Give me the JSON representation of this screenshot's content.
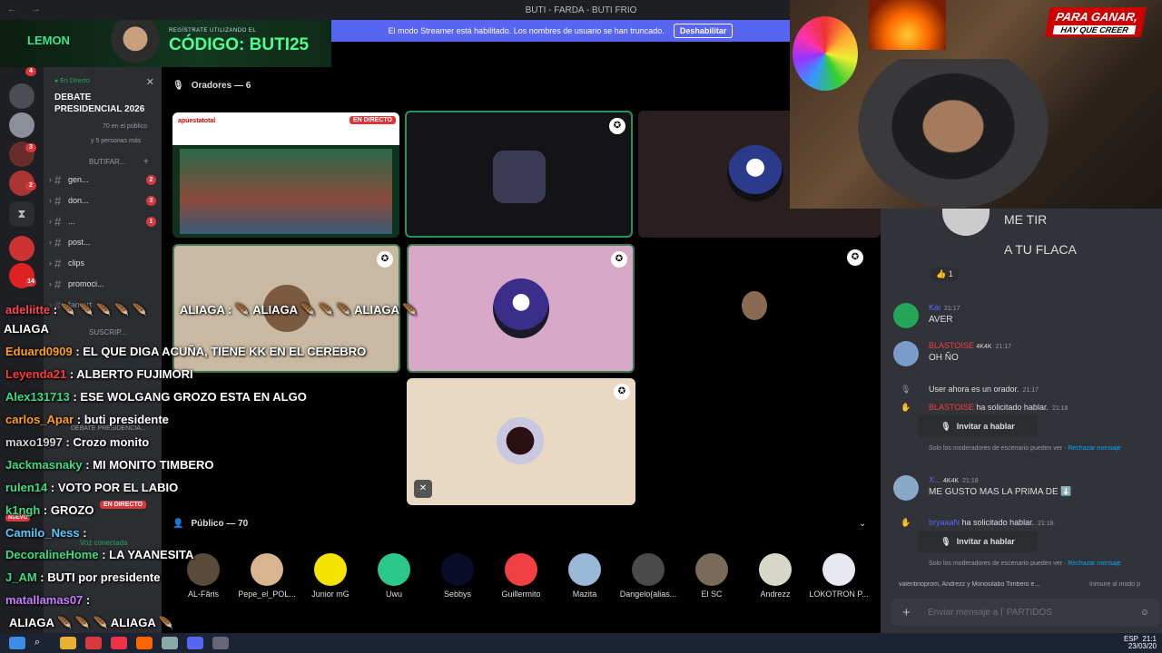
{
  "window": {
    "title": "BUTI - FARDA - BUTI FRIO",
    "nav_arrows": "← →"
  },
  "streamer_banner": {
    "text": "El modo Streamer está habilitado. Los nombres de usuario se han truncado.",
    "button": "Deshabilitar"
  },
  "promo": {
    "brand": "LEMON",
    "hint": "REGÍSTRATE UTILIZANDO EL",
    "code": "CÓDIGO: BUTI25"
  },
  "server_rail": {
    "badges": [
      "4",
      "3",
      "2",
      "14"
    ]
  },
  "channel_list": {
    "live_label": "En Directo",
    "event_title": "DEBATE PRESIDENCIAL 2026",
    "audience": "70 en el público",
    "people": "y 5 personas más",
    "category": "BUTIFAR...",
    "channels": [
      {
        "name": "gen...",
        "count": "2"
      },
      {
        "name": "don...",
        "count": "3"
      },
      {
        "name": "...",
        "count": "1"
      },
      {
        "name": "post...",
        "count": ""
      },
      {
        "name": "clips",
        "count": ""
      },
      {
        "name": "promoci...",
        "count": ""
      },
      {
        "name": "fan-art",
        "count": ""
      }
    ],
    "category2": "SUSCRIP...",
    "voice_label": "DEBATE PRESIDENCIA...",
    "voice_status": "Voz conectada",
    "live_badge": "EN DIRECTO",
    "nuevo": "NUEVO"
  },
  "stage": {
    "speakers_header": "Oradores — 6",
    "audience_header": "Público — 70",
    "en_directo": "EN DIRECTO",
    "stream_brand": "apuestatotal",
    "audience": [
      "AL-Fâris",
      "Pepe_el_POL...",
      "Junior mG",
      "Uwu",
      "Sebbys",
      "Guillermito",
      "Mazita",
      "Dangelo(alias...",
      "El SC",
      "Andrezz",
      "LOKOTRON P..."
    ]
  },
  "webcam": {
    "slogan_top": "PARA GANAR,",
    "slogan_bottom": "HAY QUE CREER"
  },
  "chat": {
    "top_lines": [
      "ME TIR",
      "A TU FLACA"
    ],
    "reaction_count": "1",
    "messages": [
      {
        "user": "Kai",
        "time": "21:17",
        "text": "AVER",
        "color": "#5865f2"
      },
      {
        "user": "BLASTOISE",
        "tag": "4K4K",
        "time": "21:17",
        "text": "OH ÑO",
        "color": "#f23f43"
      }
    ],
    "system": [
      {
        "text": "User ahora es un orador.",
        "time": "21:17"
      },
      {
        "user": "BLASTOISE",
        "text": "ha solicitado hablar.",
        "time": "21:18"
      }
    ],
    "invite_label": "Invitar a hablar",
    "mod_note": "Solo los moderadores de escenario pueden ver",
    "mod_link": "Rechazar mensaje",
    "msg3": {
      "user": "X...",
      "tag": "4K4K",
      "time": "21:18",
      "text": "ME GUSTO MAS LA PRIMA DE ⬇️"
    },
    "req2": {
      "user": "bryaaaN",
      "text": "ha solicitado hablar.",
      "time": "21:18"
    },
    "typing": "valentinoprom, Andrezz y Monosilabo Timbero e...",
    "typing_right": "Inmune al modo p",
    "input_placeholder": "Enviar mensaje a",
    "input_channel": "PARTIDOS"
  },
  "overlay": [
    {
      "user": "adeliitte",
      "text": "",
      "color": "#ff4757"
    },
    {
      "user": "ALIAGA",
      "text": "",
      "color": "#ffffff"
    },
    {
      "user": "Eduard0909",
      "text": "EL QUE DIGA ACUÑA, TIENE KK EN EL CEREBRO",
      "color": "#ff9f1a"
    },
    {
      "user": "Leyenda21",
      "text": "ALBERTO FUJIMORI",
      "color": "#ff3b30"
    },
    {
      "user": "Alex131713",
      "text": "ESE WOLGANG GROZO ESTA EN ALGO",
      "color": "#3ddc84"
    },
    {
      "user": "carlos_Apar",
      "text": "buti presidente",
      "color": "#ff9f1a"
    },
    {
      "user": "maxo1997",
      "text": "Crozo monito",
      "color": "#d0d0d0"
    },
    {
      "user": "Jackmasnaky",
      "text": "MI MONITO TIMBERO",
      "color": "#3ddc84"
    },
    {
      "user": "rulen14",
      "text": "VOTO POR EL LABIO",
      "color": "#3ddc84"
    },
    {
      "user": "k1ngh",
      "text": "GROZO",
      "color": "#3ddc84"
    },
    {
      "user": "Camilo_Ness",
      "text": "",
      "color": "#5ac8fa"
    },
    {
      "user": "DecoralineHome",
      "text": "LA YAANESITA",
      "color": "#3ddc84"
    },
    {
      "user": "J_AM",
      "text": "BUTI por presidente",
      "color": "#3ddc84"
    },
    {
      "user": "matallamas07",
      "text": "",
      "color": "#c77dff"
    },
    {
      "user": "ALIAGA",
      "text": "ALIAGA",
      "color": "#ffffff"
    }
  ],
  "overlay_stage_text": "ALIAGA :",
  "taskbar": {
    "lang": "ESP",
    "time": "21:1",
    "date": "23/03/20"
  }
}
